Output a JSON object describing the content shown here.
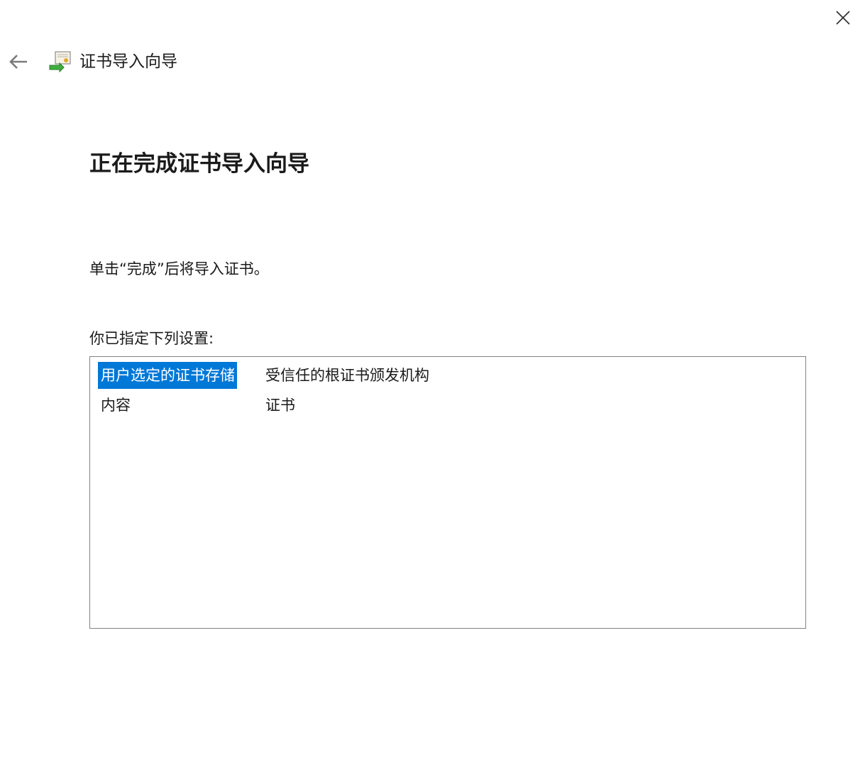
{
  "window": {
    "title": "证书导入向导",
    "close_icon": "close-icon",
    "back_icon": "back-arrow-icon",
    "app_icon": "certificate-wizard-icon"
  },
  "main": {
    "heading": "正在完成证书导入向导",
    "instruction": "单击“完成”后将导入证书。",
    "settings_label": "你已指定下列设置:",
    "settings": [
      {
        "name": "用户选定的证书存储",
        "value": "受信任的根证书颁发机构",
        "selected": true
      },
      {
        "name": "内容",
        "value": "证书",
        "selected": false
      }
    ]
  },
  "colors": {
    "selection": "#0078d7",
    "border": "#828282",
    "text": "#1a1a1a",
    "icon_gray": "#7a7a7a"
  }
}
